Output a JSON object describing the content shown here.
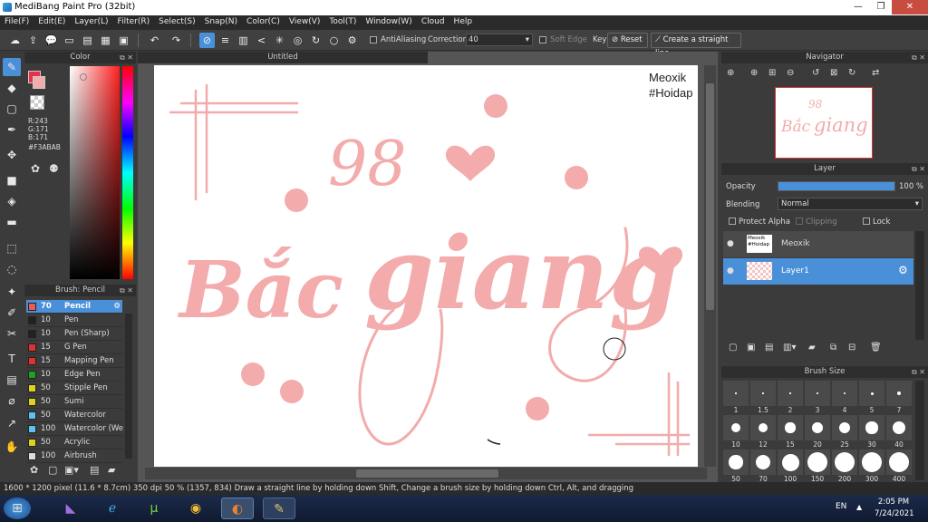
{
  "window": {
    "title": "MediBang Paint Pro (32bit)"
  },
  "menu": [
    "File(F)",
    "Edit(E)",
    "Layer(L)",
    "Filter(R)",
    "Select(S)",
    "Snap(N)",
    "Color(C)",
    "View(V)",
    "Tool(T)",
    "Window(W)",
    "Cloud",
    "Help"
  ],
  "toolbar": {
    "antialiasing": "AntiAliasing",
    "correction_label": "Correction",
    "correction_value": "40",
    "soft_edge": "Soft Edge",
    "key": "Key",
    "reset": "Reset",
    "straight_line": "Create a straight line"
  },
  "color_panel": {
    "title": "Color",
    "r": "R:243",
    "g": "G:171",
    "b": "B:171",
    "hex": "#F3ABAB",
    "colors": {
      "primary": "#F3ABAB",
      "accent": "#E8304C"
    }
  },
  "brush_panel": {
    "title": "Brush: Pencil",
    "items": [
      {
        "size": "70",
        "name": "Pencil",
        "color": "#e85a5a"
      },
      {
        "size": "10",
        "name": "Pen",
        "color": "#222222"
      },
      {
        "size": "10",
        "name": "Pen (Sharp)",
        "color": "#222222"
      },
      {
        "size": "15",
        "name": "G Pen",
        "color": "#e03030"
      },
      {
        "size": "15",
        "name": "Mapping Pen",
        "color": "#e03030"
      },
      {
        "size": "10",
        "name": "Edge Pen",
        "color": "#20a020"
      },
      {
        "size": "50",
        "name": "Stipple Pen",
        "color": "#e0d020"
      },
      {
        "size": "50",
        "name": "Sumi",
        "color": "#e0d020"
      },
      {
        "size": "50",
        "name": "Watercolor",
        "color": "#60c0f0"
      },
      {
        "size": "100",
        "name": "Watercolor (We",
        "color": "#60c0f0"
      },
      {
        "size": "50",
        "name": "Acrylic",
        "color": "#e0d020"
      },
      {
        "size": "100",
        "name": "Airbrush",
        "color": "#dddddd"
      }
    ]
  },
  "canvas": {
    "tab": "Untitled",
    "watermark_line1": "Meoxik",
    "watermark_line2": "#Hoidap",
    "art_num": "98",
    "art_word1": "Bắc",
    "art_word2": "giang"
  },
  "navigator": {
    "title": "Navigator"
  },
  "layer_panel": {
    "title": "Layer",
    "opacity_label": "Opacity",
    "opacity_value": "100 %",
    "opacity": 1.0,
    "blending_label": "Blending",
    "blending_value": "Normal",
    "protect_alpha": "Protect Alpha",
    "clipping": "Clipping",
    "lock": "Lock",
    "layers": [
      {
        "name": "Meoxik",
        "thumb1": "Meoxik",
        "thumb2": "#Hoidap"
      },
      {
        "name": "Layer1"
      }
    ]
  },
  "brush_size": {
    "title": "Brush Size",
    "sizes": [
      "1",
      "1.5",
      "2",
      "3",
      "4",
      "5",
      "7",
      "10",
      "12",
      "15",
      "20",
      "25",
      "30",
      "40",
      "50",
      "70",
      "100",
      "150",
      "200",
      "300",
      "400"
    ]
  },
  "status": {
    "size": "1600 * 1200 pixel",
    "cm": "(11.6 * 8.7cm)",
    "dpi": "350 dpi",
    "zoom": "50 %",
    "coords": "(1357, 834)",
    "hint": "Draw a straight line by holding down Shift, Change a brush size by holding down Ctrl, Alt, and dragging"
  },
  "taskbar": {
    "lang": "EN",
    "time": "2:05 PM",
    "date": "7/24/2021",
    "apps": [
      "start-orb",
      "visual-studio-icon",
      "ie-icon",
      "utorrent-icon",
      "chrome-icon",
      "medibang-icon",
      "paint-icon"
    ]
  }
}
